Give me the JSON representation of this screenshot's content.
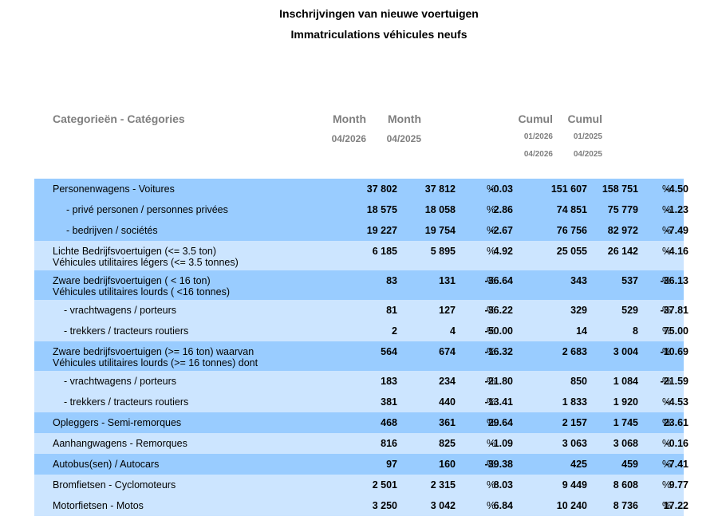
{
  "title_nl": "Inschrijvingen van nieuwe voertuigen",
  "title_fr": "Immatriculations véhicules neufs",
  "header": {
    "category": "Categorieën - Catégories",
    "month": "Month",
    "month_cur": "04/2026",
    "month_prev": "04/2025",
    "cumul": "Cumul",
    "cumul_cur_from": "01/2026",
    "cumul_cur_to": "04/2026",
    "cumul_prev_from": "01/2025",
    "cumul_prev_to": "04/2025"
  },
  "colors": {
    "blue": "#99ccff",
    "light": "#cce5ff",
    "header_text": "#7f7f7f"
  },
  "pct_sign": "%",
  "rows": [
    {
      "label": [
        "Personenwagens - Voitures"
      ],
      "indent": 0,
      "m26": "37 802",
      "m25": "37 812",
      "mchg": "-0.03",
      "c26": "151 607",
      "c25": "158 751",
      "cchg": "-4.50",
      "bg": "blue",
      "h": 26
    },
    {
      "label": [
        "- privé personen / personnes privées"
      ],
      "indent": 1,
      "m26": "18 575",
      "m25": "18 058",
      "mchg": "2.86",
      "c26": "74 851",
      "c25": "75 779",
      "cchg": "-1.23",
      "bg": "blue",
      "h": 26
    },
    {
      "label": [
        "- bedrijven / sociétés"
      ],
      "indent": 1,
      "m26": "19 227",
      "m25": "19 754",
      "mchg": "-2.67",
      "c26": "76 756",
      "c25": "82 972",
      "cchg": "-7.49",
      "bg": "blue",
      "h": 26
    },
    {
      "label": [
        "Lichte Bedrijfsvoertuigen (<= 3.5 ton)",
        "Véhicules utilitaires légers (<= 3.5 tonnes)"
      ],
      "indent": 0,
      "m26": "6 185",
      "m25": "5 895",
      "mchg": "4.92",
      "c26": "25 055",
      "c25": "26 142",
      "cchg": "-4.16",
      "bg": "light",
      "h": 37
    },
    {
      "label": [
        "Zware bedrijfsvoertuigen ( < 16 ton)",
        "Véhicules utilitaires lourds ( <16 tonnes)"
      ],
      "indent": 0,
      "m26": "83",
      "m25": "131",
      "mchg": "-36.64",
      "c26": "343",
      "c25": "537",
      "cchg": "-36.13",
      "bg": "blue",
      "h": 37
    },
    {
      "label": [
        "- vrachtwagens / porteurs"
      ],
      "indent": 2,
      "m26": "81",
      "m25": "127",
      "mchg": "-36.22",
      "c26": "329",
      "c25": "529",
      "cchg": "-37.81",
      "bg": "light",
      "h": 26
    },
    {
      "label": [
        "- trekkers / tracteurs routiers"
      ],
      "indent": 2,
      "m26": "2",
      "m25": "4",
      "mchg": "-50.00",
      "c26": "14",
      "c25": "8",
      "cchg": "75.00",
      "bg": "light",
      "h": 26
    },
    {
      "label": [
        "Zware bedrijfsvoertuigen (>= 16 ton) waarvan",
        "Véhicules utilitaires lourds (>= 16 tonnes) dont"
      ],
      "indent": 0,
      "m26": "564",
      "m25": "674",
      "mchg": "-16.32",
      "c26": "2 683",
      "c25": "3 004",
      "cchg": "-10.69",
      "bg": "blue",
      "h": 37
    },
    {
      "label": [
        "- vrachtwagens / porteurs"
      ],
      "indent": 2,
      "m26": "183",
      "m25": "234",
      "mchg": "-21.80",
      "c26": "850",
      "c25": "1 084",
      "cchg": "-21.59",
      "bg": "light",
      "h": 26
    },
    {
      "label": [
        "- trekkers / tracteurs routiers"
      ],
      "indent": 2,
      "m26": "381",
      "m25": "440",
      "mchg": "-13.41",
      "c26": "1 833",
      "c25": "1 920",
      "cchg": "-4.53",
      "bg": "light",
      "h": 26
    },
    {
      "label": [
        "Opleggers - Semi-remorques"
      ],
      "indent": 0,
      "m26": "468",
      "m25": "361",
      "mchg": "29.64",
      "c26": "2 157",
      "c25": "1 745",
      "cchg": "23.61",
      "bg": "blue",
      "h": 26
    },
    {
      "label": [
        "Aanhangwagens - Remorques"
      ],
      "indent": 0,
      "m26": "816",
      "m25": "825",
      "mchg": "-1.09",
      "c26": "3 063",
      "c25": "3 068",
      "cchg": "-0.16",
      "bg": "light",
      "h": 26
    },
    {
      "label": [
        "Autobus(sen) / Autocars"
      ],
      "indent": 0,
      "m26": "97",
      "m25": "160",
      "mchg": "-39.38",
      "c26": "425",
      "c25": "459",
      "cchg": "-7.41",
      "bg": "blue",
      "h": 26
    },
    {
      "label": [
        "Bromfietsen - Cyclomoteurs"
      ],
      "indent": 0,
      "m26": "2 501",
      "m25": "2 315",
      "mchg": "8.03",
      "c26": "9 449",
      "c25": "8 608",
      "cchg": "9.77",
      "bg": "light",
      "h": 26
    },
    {
      "label": [
        "Motorfietsen - Motos"
      ],
      "indent": 0,
      "m26": "3 250",
      "m25": "3 042",
      "mchg": "6.84",
      "c26": "10 240",
      "c25": "8 736",
      "cchg": "17.22",
      "bg": "light",
      "h": 26
    }
  ]
}
